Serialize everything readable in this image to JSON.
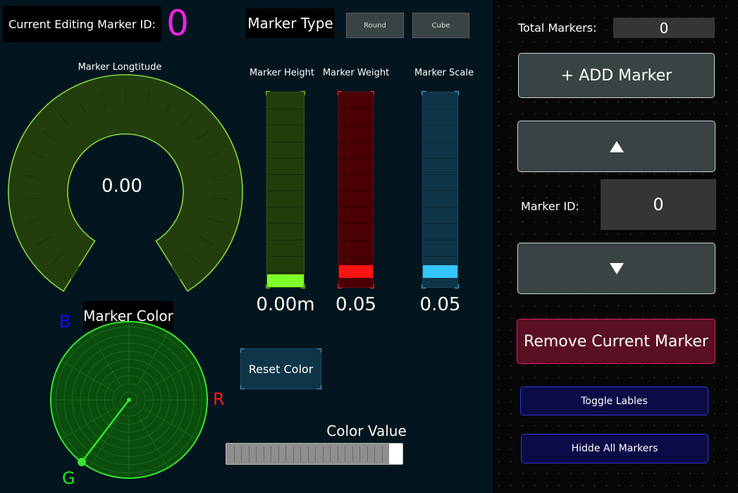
{
  "editing": {
    "label": "Current Editing Marker ID:",
    "value": "0"
  },
  "marker_type": {
    "label": "Marker Type",
    "buttons": [
      "Round",
      "Cube"
    ]
  },
  "longitude": {
    "label": "Marker Longtitude",
    "value": "0.00"
  },
  "sliders": [
    {
      "label": "Marker Height",
      "value": "0.00m",
      "level": 0.0,
      "color": "#7fff2a",
      "track": "#233c0c",
      "accent": "#6fd21d"
    },
    {
      "label": "Marker Weight",
      "value": "0.05",
      "level": 0.05,
      "color": "#ff1313",
      "track": "#4a0005",
      "accent": "#ff2d2d"
    },
    {
      "label": "Marker Scale",
      "value": "0.05",
      "level": 0.05,
      "color": "#34c4ff",
      "track": "#0f3447",
      "accent": "#3fb5f0"
    }
  ],
  "color_picker": {
    "label": "Marker Color",
    "axes": {
      "b": "B",
      "r": "R",
      "g": "G"
    },
    "reset_label": "Reset Color",
    "value_label": "Color Value",
    "value_level": 1.0
  },
  "right": {
    "total_label": "Total Markers:",
    "total_value": "0",
    "add_label": "+ ADD Marker",
    "up_icon": "triangle-up-icon",
    "marker_id_label": "Marker ID:",
    "marker_id_value": "0",
    "down_icon": "triangle-down-icon",
    "remove_label": "Remove Current Marker",
    "toggle_label": "Toggle Lables",
    "hide_label": "Hidde All Markers"
  },
  "colors": {
    "accent_magenta": "#ee22e0",
    "dial_green": "#7fdc3a",
    "picker_green": "#37e62f",
    "remove_pink": "#e0206a"
  }
}
